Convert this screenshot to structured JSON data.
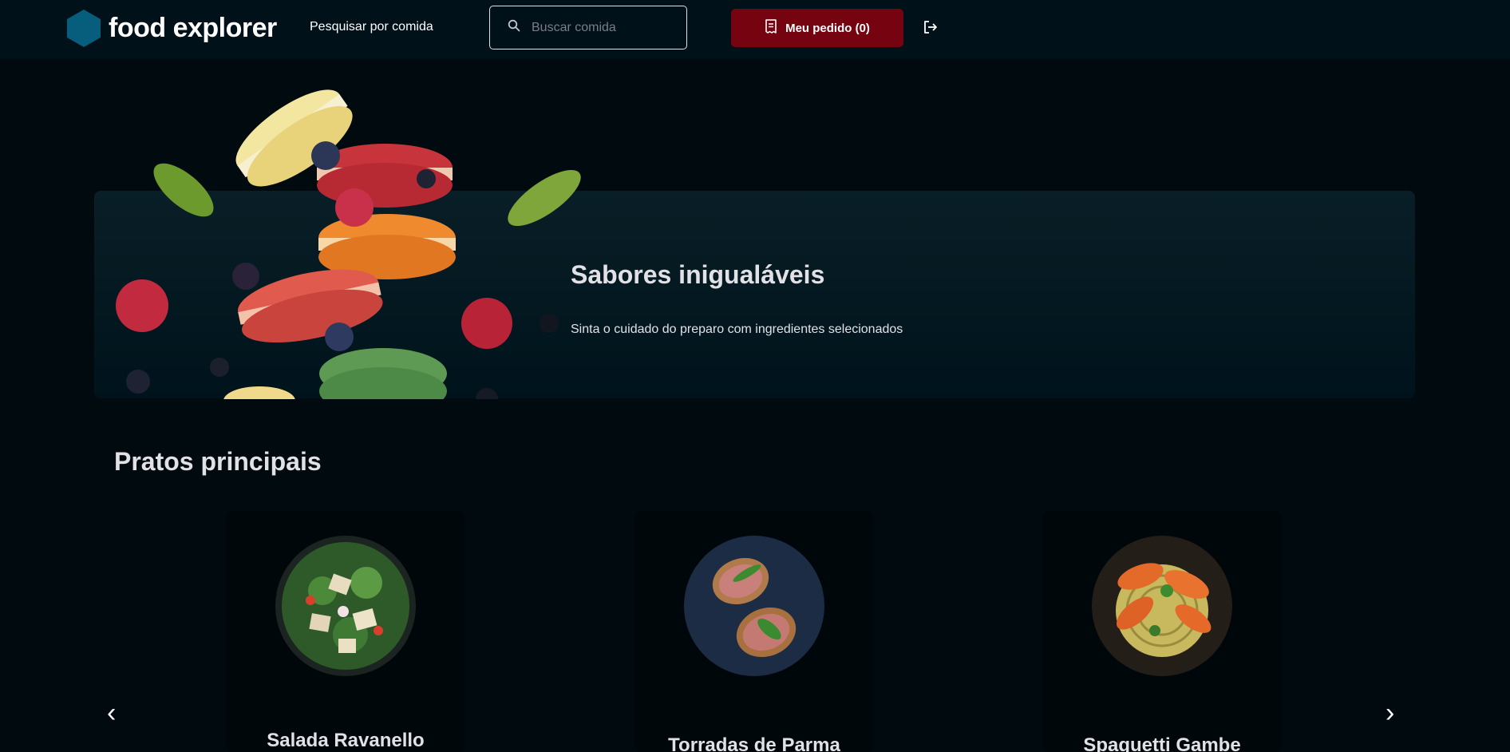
{
  "header": {
    "brand": "food explorer",
    "nav_link": "Pesquisar por comida",
    "search_placeholder": "Buscar comida",
    "order_button": "Meu pedido (0)"
  },
  "banner": {
    "title": "Sabores inigualáveis",
    "subtitle": "Sinta o cuidado do preparo com ingredientes selecionados"
  },
  "section": {
    "title": "Pratos principais"
  },
  "dishes": [
    {
      "name": "Salada Ravanello"
    },
    {
      "name": "Torradas de Parma"
    },
    {
      "name": "Spaguetti Gambe"
    }
  ],
  "carousel": {
    "prev": "‹",
    "next": "›"
  },
  "colors": {
    "background": "#000A0F",
    "header": "#00111A",
    "accent": "#750310",
    "brand_icon": "#065E7C"
  }
}
